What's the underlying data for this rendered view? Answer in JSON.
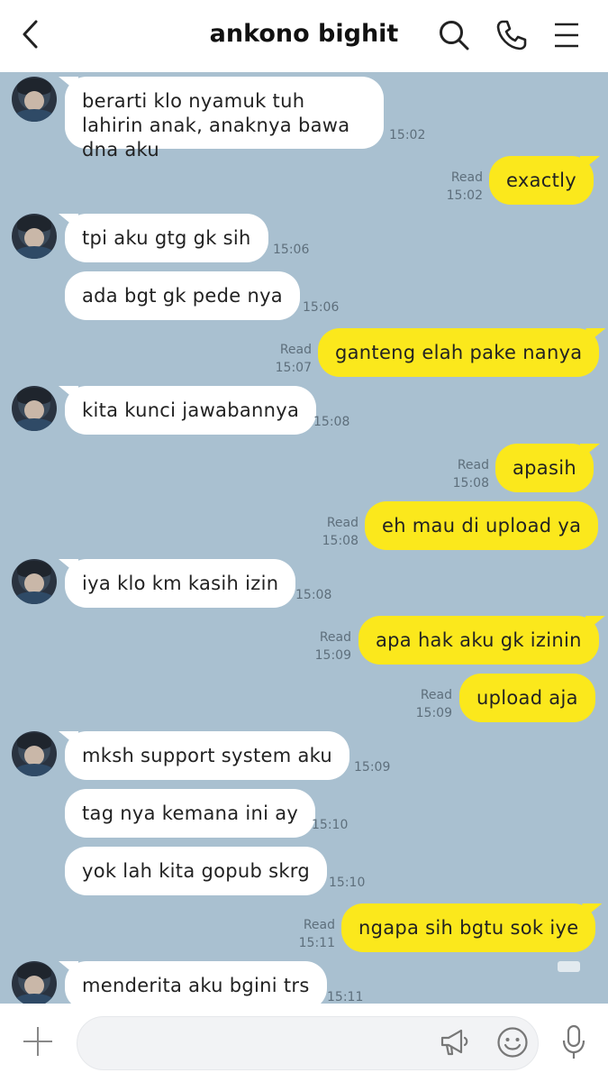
{
  "header": {
    "title": "ankono bighit",
    "back_icon": "chevron-left-icon",
    "search_icon": "search-icon",
    "call_icon": "phone-icon",
    "menu_icon": "menu-icon"
  },
  "messages": [
    {
      "side": "in",
      "text": "berarti klo nyamuk tuh lahirin anak, anaknya bawa dna aku",
      "time": "15:02"
    },
    {
      "side": "out",
      "text": "exactly",
      "status": "Read",
      "time": "15:02"
    },
    {
      "side": "in",
      "text": "tpi aku gtg gk sih",
      "time": "15:06"
    },
    {
      "side": "in",
      "text": "ada bgt gk pede nya",
      "time": "15:06"
    },
    {
      "side": "out",
      "text": "ganteng elah pake nanya",
      "status": "Read",
      "time": "15:07"
    },
    {
      "side": "in",
      "text": "kita kunci jawabannya",
      "time": "15:08"
    },
    {
      "side": "out",
      "text": "apasih",
      "status": "Read",
      "time": "15:08"
    },
    {
      "side": "out",
      "text": "eh mau di upload ya",
      "status": "Read",
      "time": "15:08"
    },
    {
      "side": "in",
      "text": "iya klo km kasih izin",
      "time": "15:08"
    },
    {
      "side": "out",
      "text": "apa hak aku gk izinin",
      "status": "Read",
      "time": "15:09"
    },
    {
      "side": "out",
      "text": "upload aja",
      "status": "Read",
      "time": "15:09"
    },
    {
      "side": "in",
      "text": "mksh support system aku",
      "time": "15:09"
    },
    {
      "side": "in",
      "text": "tag nya kemana ini ay",
      "time": "15:10"
    },
    {
      "side": "in",
      "text": "yok lah kita gopub skrg",
      "time": "15:10"
    },
    {
      "side": "out",
      "text": "ngapa sih bgtu sok iye",
      "status": "Read",
      "time": "15:11"
    },
    {
      "side": "in",
      "text": "menderita aku bgini trs",
      "time": "15:11"
    }
  ],
  "composer": {
    "plus_icon": "plus-icon",
    "input_value": "",
    "announce_icon": "megaphone-icon",
    "emoji_icon": "emoji-icon",
    "mic_icon": "microphone-icon"
  },
  "colors": {
    "background": "#a9c0d0",
    "incoming_bubble": "#ffffff",
    "outgoing_bubble": "#fbe81c",
    "meta_text": "#5e6f7c"
  }
}
